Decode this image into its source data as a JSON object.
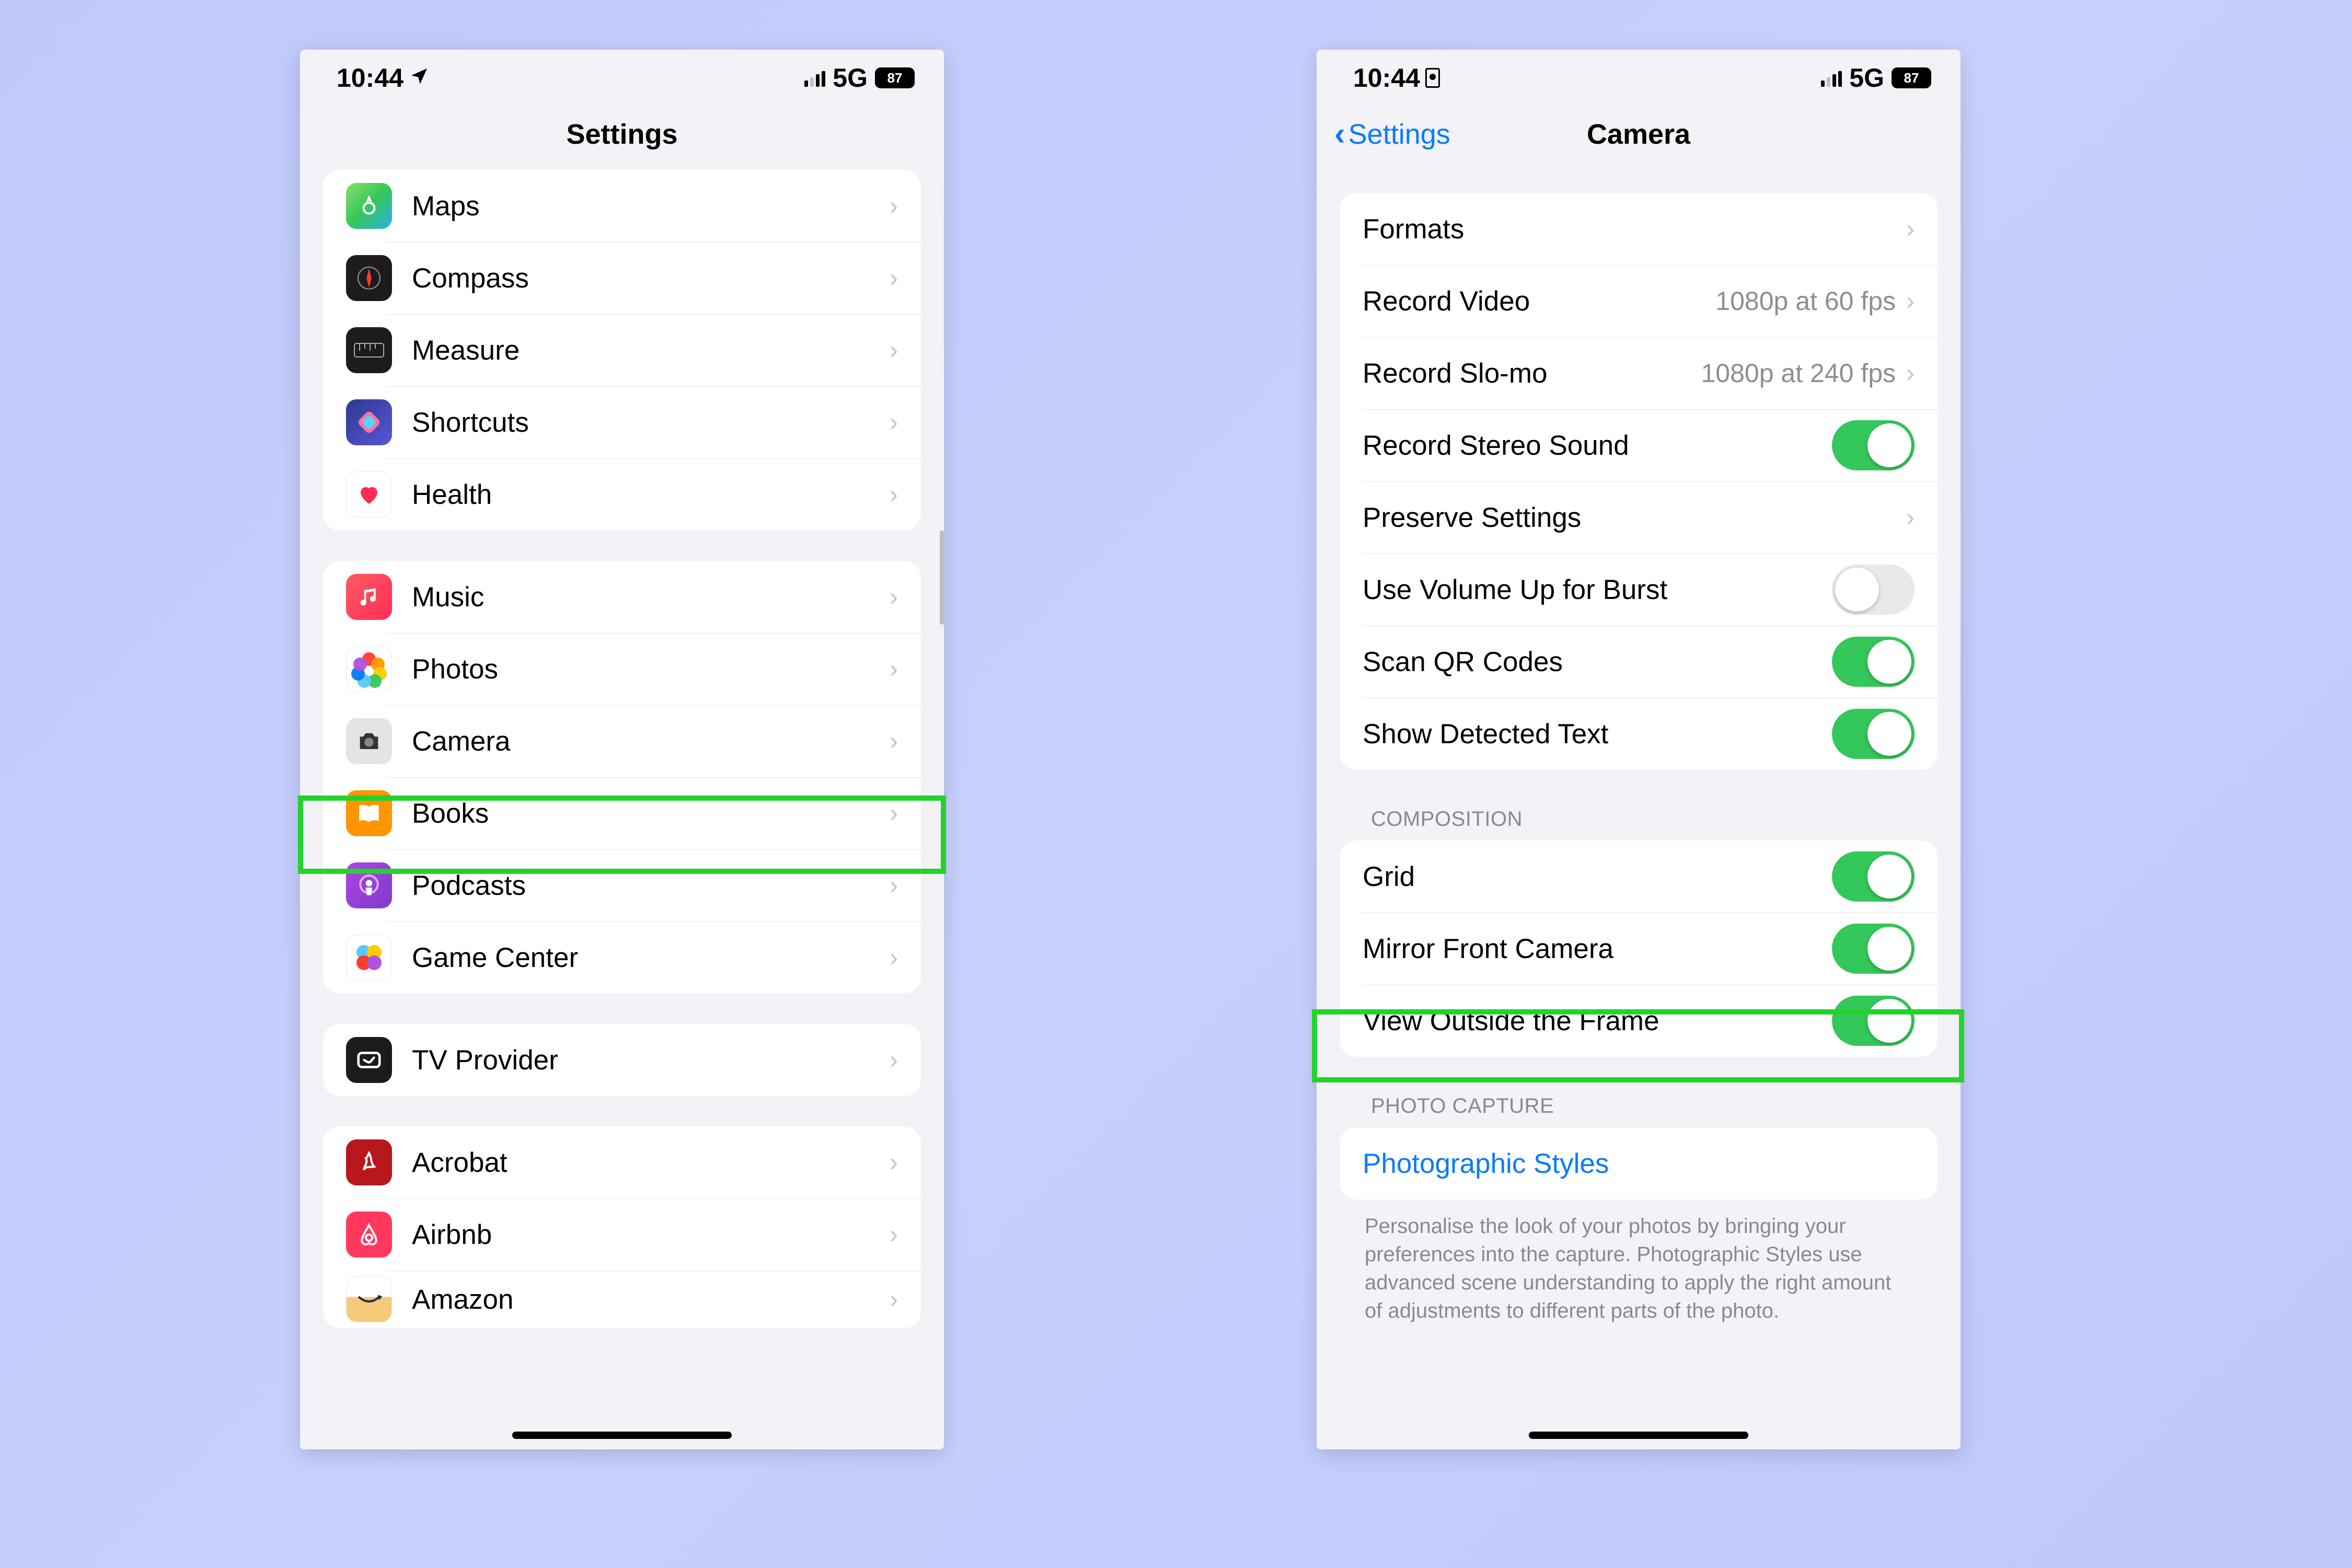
{
  "status": {
    "time": "10:44",
    "network_label": "5G",
    "battery_percent": "87"
  },
  "left": {
    "title": "Settings",
    "groups": [
      {
        "items": [
          {
            "label": "Maps",
            "icon": "maps"
          },
          {
            "label": "Compass",
            "icon": "compass"
          },
          {
            "label": "Measure",
            "icon": "measure"
          },
          {
            "label": "Shortcuts",
            "icon": "shortcuts"
          },
          {
            "label": "Health",
            "icon": "health"
          }
        ]
      },
      {
        "items": [
          {
            "label": "Music",
            "icon": "music"
          },
          {
            "label": "Photos",
            "icon": "photos"
          },
          {
            "label": "Camera",
            "icon": "camera",
            "highlight": true
          },
          {
            "label": "Books",
            "icon": "books"
          },
          {
            "label": "Podcasts",
            "icon": "podcasts"
          },
          {
            "label": "Game Center",
            "icon": "gamecenter"
          }
        ]
      },
      {
        "items": [
          {
            "label": "TV Provider",
            "icon": "tv"
          }
        ]
      },
      {
        "items": [
          {
            "label": "Acrobat",
            "icon": "acrobat"
          },
          {
            "label": "Airbnb",
            "icon": "airbnb"
          },
          {
            "label": "Amazon",
            "icon": "amazon"
          }
        ]
      }
    ]
  },
  "right": {
    "back_label": "Settings",
    "title": "Camera",
    "sections": [
      {
        "header": "",
        "rows": [
          {
            "type": "nav",
            "label": "Formats"
          },
          {
            "type": "nav",
            "label": "Record Video",
            "detail": "1080p at 60 fps"
          },
          {
            "type": "nav",
            "label": "Record Slo-mo",
            "detail": "1080p at 240 fps"
          },
          {
            "type": "toggle",
            "label": "Record Stereo Sound",
            "on": true
          },
          {
            "type": "nav",
            "label": "Preserve Settings"
          },
          {
            "type": "toggle",
            "label": "Use Volume Up for Burst",
            "on": false
          },
          {
            "type": "toggle",
            "label": "Scan QR Codes",
            "on": true
          },
          {
            "type": "toggle",
            "label": "Show Detected Text",
            "on": true
          }
        ]
      },
      {
        "header": "COMPOSITION",
        "rows": [
          {
            "type": "toggle",
            "label": "Grid",
            "on": true
          },
          {
            "type": "toggle",
            "label": "Mirror Front Camera",
            "on": true,
            "highlight": true
          },
          {
            "type": "toggle",
            "label": "View Outside the Frame",
            "on": true
          }
        ]
      },
      {
        "header": "PHOTO CAPTURE",
        "rows": [
          {
            "type": "link",
            "label": "Photographic Styles"
          }
        ],
        "footer": "Personalise the look of your photos by bringing your preferences into the capture. Photographic Styles use advanced scene understanding to apply the right amount of adjustments to different parts of the photo."
      }
    ]
  }
}
